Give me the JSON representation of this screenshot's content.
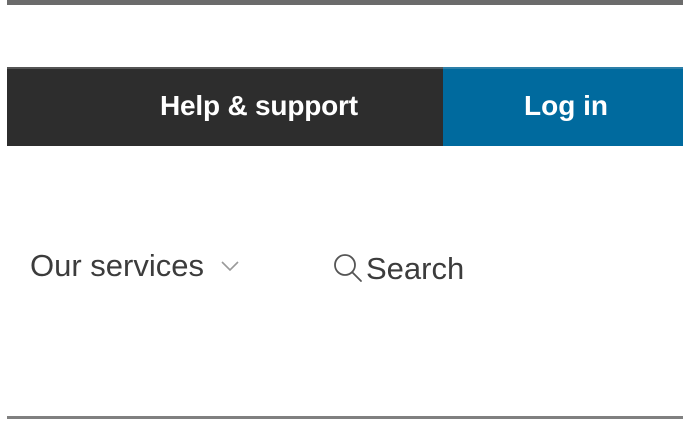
{
  "utility_bar": {
    "help_label": "Help & support",
    "login_label": "Log in"
  },
  "main_nav": {
    "services_label": "Our services",
    "services_icon": "chevron-down-icon",
    "search_label": "Search",
    "search_icon": "search-icon"
  },
  "colors": {
    "dark_bar": "#2d2d2d",
    "login_accent": "#006a9e",
    "nav_text": "#3c3c3c",
    "rule": "#6b6b6b"
  }
}
